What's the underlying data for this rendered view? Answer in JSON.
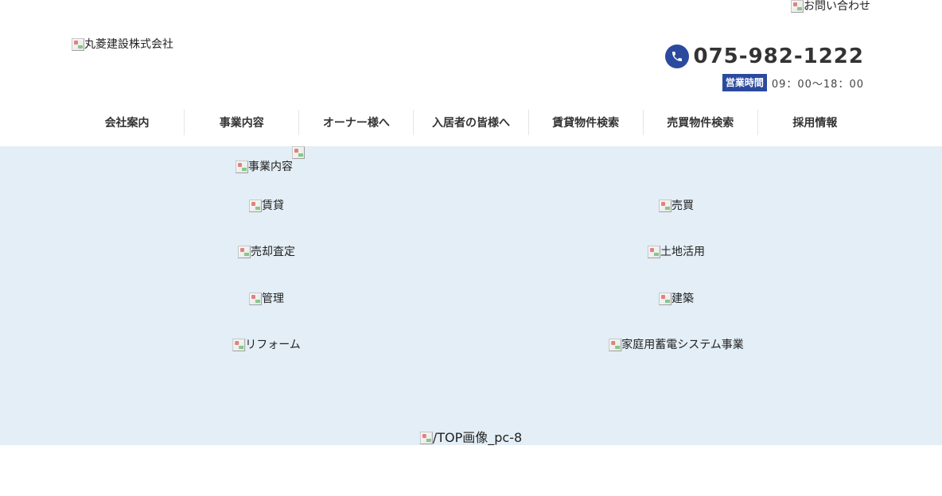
{
  "header": {
    "contact_alt": "お問い合わせ",
    "logo_alt": "丸菱建設株式会社",
    "phone": "075-982-1222",
    "hours_label": "営業時間",
    "hours": "09：00〜18：00"
  },
  "nav": {
    "items": [
      {
        "label": "会社案内"
      },
      {
        "label": "事業内容"
      },
      {
        "label": "オーナー様へ"
      },
      {
        "label": "入居者の皆様へ"
      },
      {
        "label": "賃貸物件検索"
      },
      {
        "label": "売買物件検索"
      },
      {
        "label": "採用情報"
      }
    ]
  },
  "services": {
    "heading_alt": "事業内容",
    "left": [
      {
        "alt": "賃貸"
      },
      {
        "alt": "売却査定"
      },
      {
        "alt": "管理"
      },
      {
        "alt": "リフォーム"
      }
    ],
    "right": [
      {
        "alt": "売買"
      },
      {
        "alt": "土地活用"
      },
      {
        "alt": "建築"
      },
      {
        "alt": "家庭用蓄電システム事業"
      }
    ],
    "bottom_alt": "/TOP画像_pc-8"
  },
  "colors": {
    "brand_blue": "#2b4a9e",
    "band_bg": "#e3eef6"
  }
}
